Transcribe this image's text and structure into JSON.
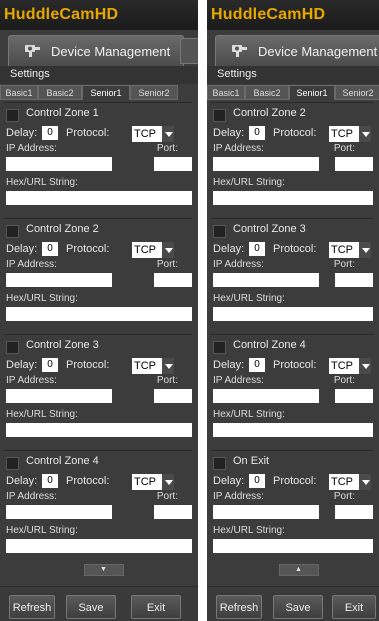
{
  "app_title": "HuddleCamHD",
  "device_tab": "Device Management",
  "settings_label": "Settings",
  "subtabs": [
    "Basic1",
    "Basic2",
    "Senior1",
    "Senior2"
  ],
  "labels": {
    "delay": "Delay:",
    "protocol": "Protocol:",
    "ip": "IP Address:",
    "port": "Port:",
    "hex": "Hex/URL String:"
  },
  "left_panel": {
    "zones": [
      {
        "name": "Control Zone 1",
        "delay": "0",
        "protocol": "TCP"
      },
      {
        "name": "Control Zone 2",
        "delay": "0",
        "protocol": "TCP"
      },
      {
        "name": "Control Zone 3",
        "delay": "0",
        "protocol": "TCP"
      },
      {
        "name": "Control Zone 4",
        "delay": "0",
        "protocol": "TCP"
      }
    ],
    "scroll_arrow": "▼"
  },
  "right_panel": {
    "zones": [
      {
        "name": "Control Zone 2",
        "delay": "0",
        "protocol": "TCP"
      },
      {
        "name": "Control Zone 3",
        "delay": "0",
        "protocol": "TCP"
      },
      {
        "name": "Control Zone 4",
        "delay": "0",
        "protocol": "TCP"
      },
      {
        "name": "On Exit",
        "delay": "0",
        "protocol": "TCP"
      }
    ],
    "scroll_arrow": "▲"
  },
  "buttons": {
    "refresh": "Refresh",
    "save": "Save",
    "exit": "Exit"
  },
  "colors": {
    "brand": "#e8a800",
    "panel": "#3c3c3c"
  },
  "icons": {
    "device": "device-management-icon",
    "dropdown": "chevron-down-icon"
  }
}
